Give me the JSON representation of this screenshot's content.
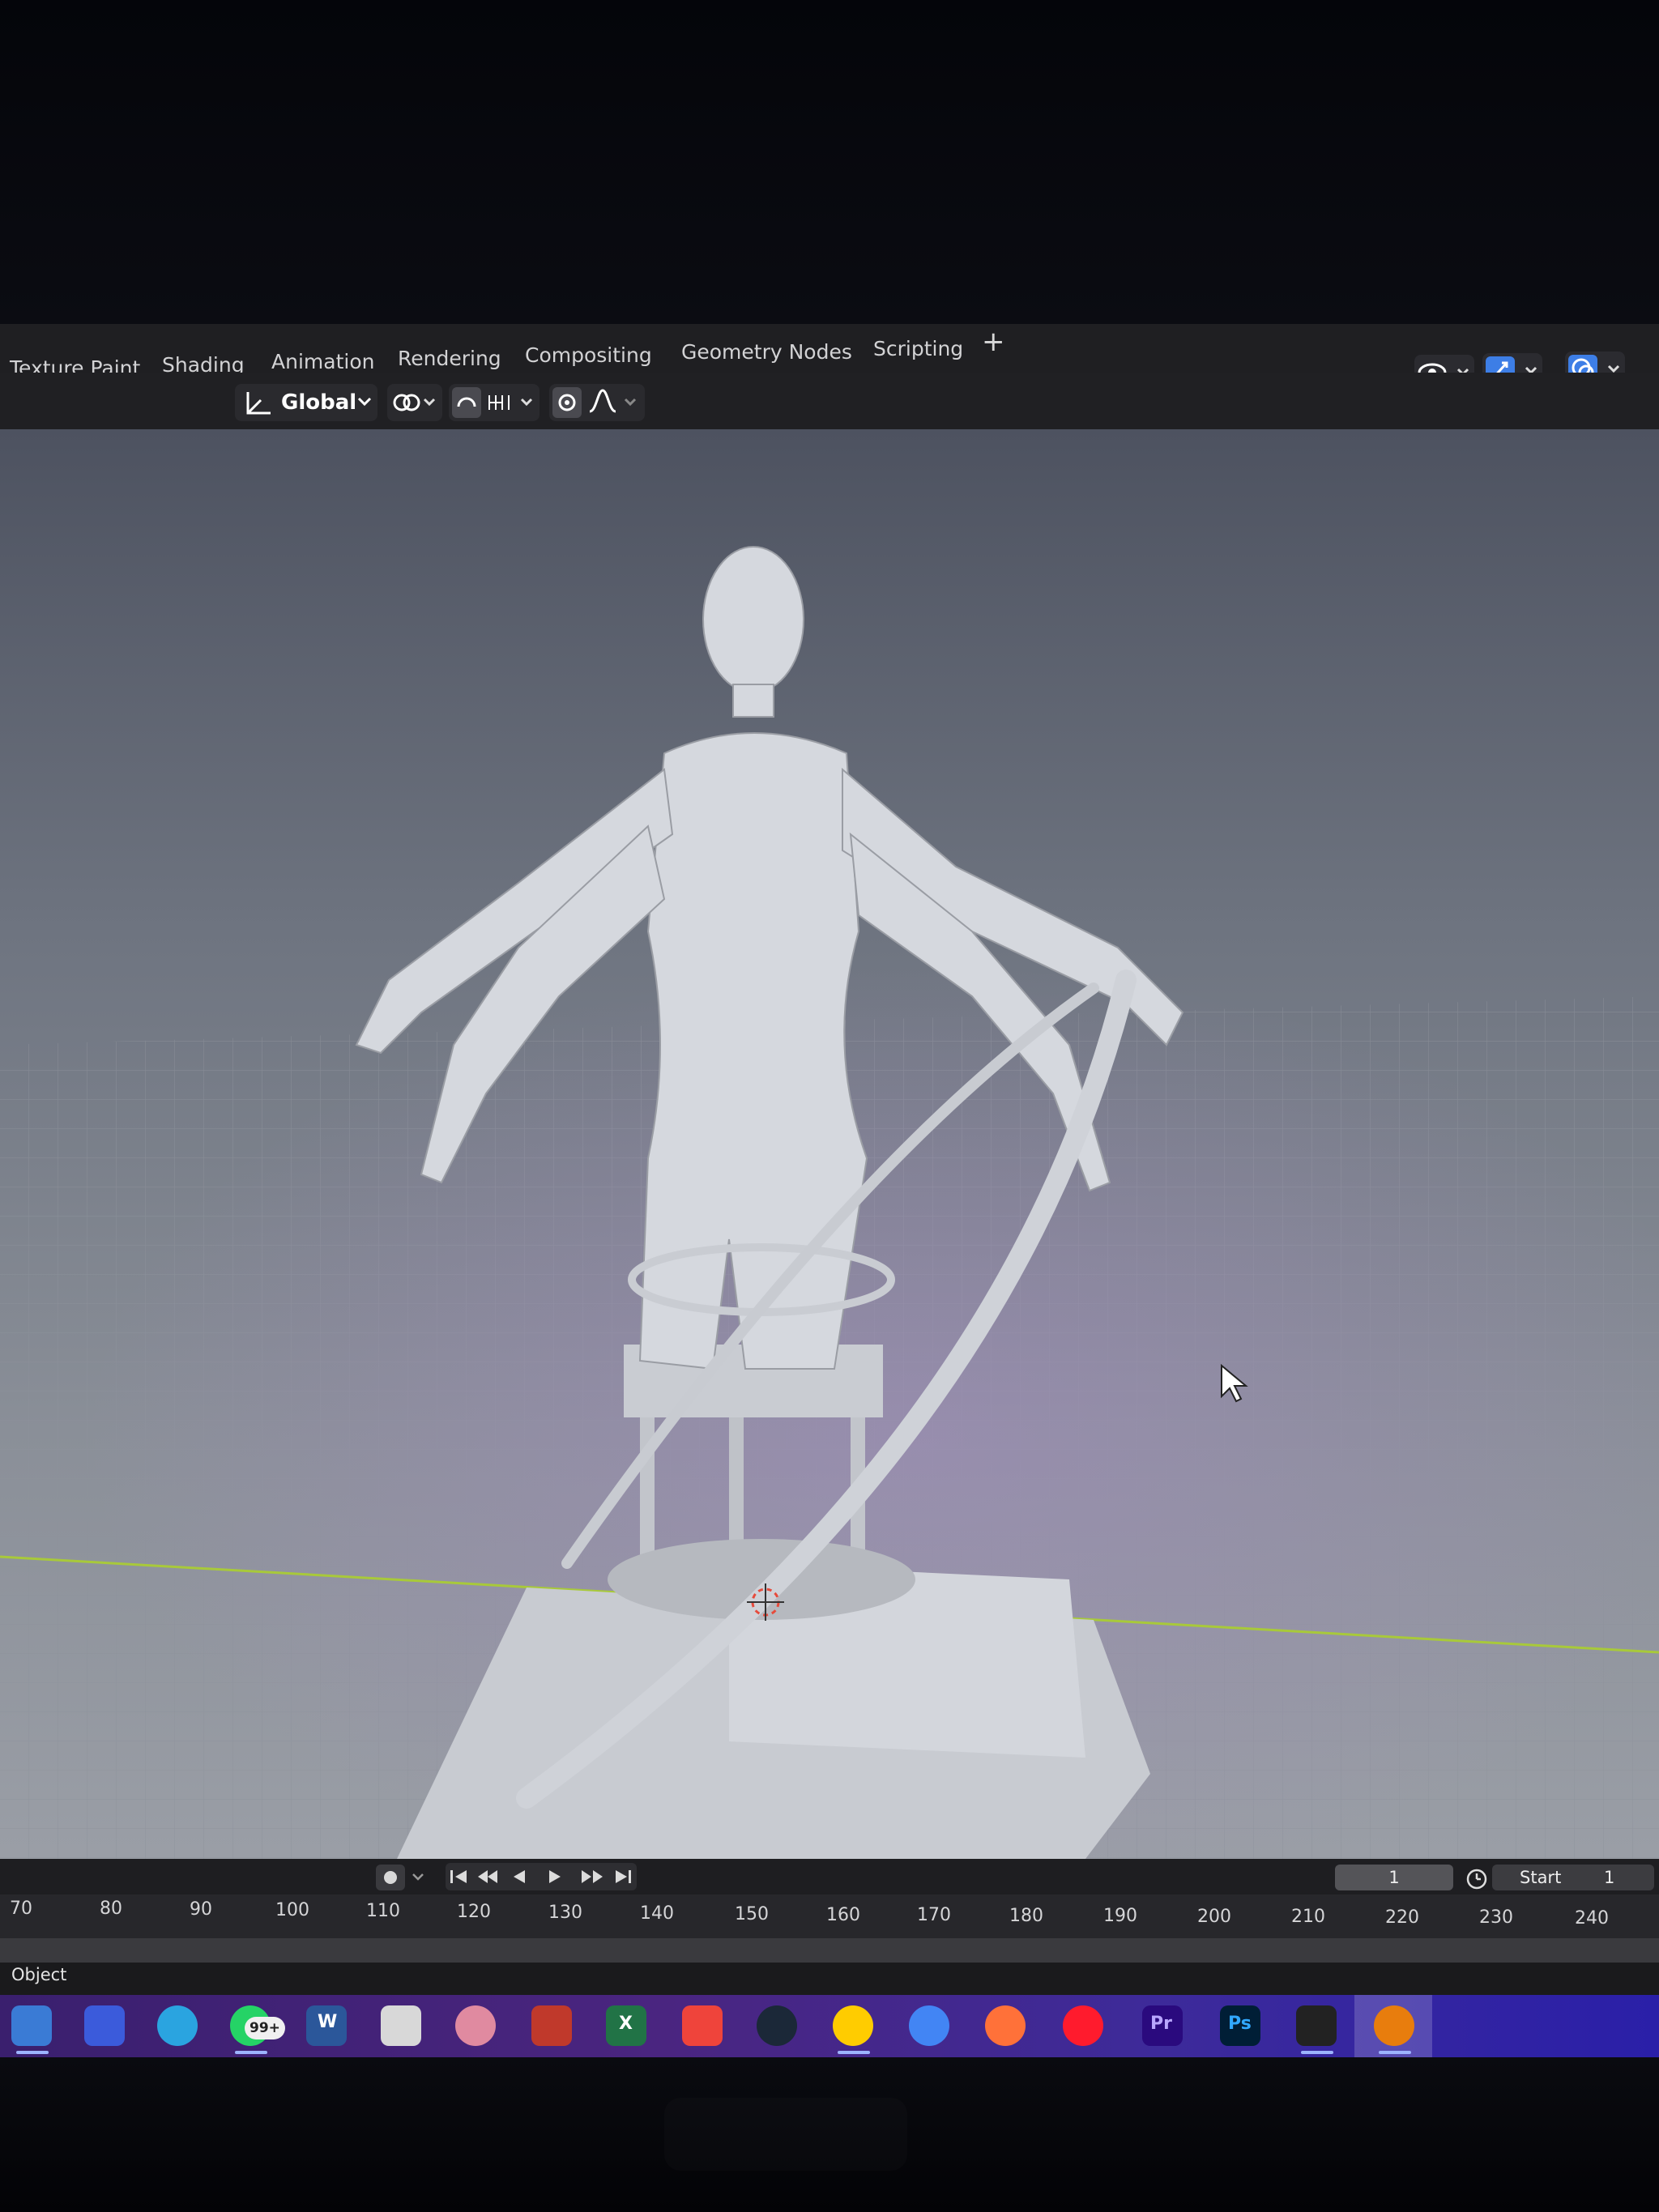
{
  "workspace_tabs": [
    "Texture Paint",
    "Shading",
    "Animation",
    "Rendering",
    "Compositing",
    "Geometry Nodes",
    "Scripting"
  ],
  "add_tab_symbol": "+",
  "toolbar": {
    "orientation": "Global"
  },
  "timeline": {
    "ruler_ticks": [
      "70",
      "80",
      "90",
      "100",
      "110",
      "120",
      "130",
      "140",
      "150",
      "160",
      "170",
      "180",
      "190",
      "200",
      "210",
      "220",
      "230",
      "240"
    ],
    "current_frame": "1",
    "start_label": "Start",
    "start_value": "1"
  },
  "status_bar": {
    "mode": "Object"
  },
  "taskbar": {
    "notification_badge": "99+",
    "apps": [
      {
        "name": "browser-pinned",
        "color": "#3a7bd5"
      },
      {
        "name": "app-2",
        "color": "#3b5bdb"
      },
      {
        "name": "telegram",
        "color": "#2aa4e0"
      },
      {
        "name": "whatsapp",
        "color": "#25d366"
      },
      {
        "name": "word",
        "color": "#2b579a"
      },
      {
        "name": "notes",
        "color": "#d8d8d8"
      },
      {
        "name": "brain-app",
        "color": "#e08aa0"
      },
      {
        "name": "recorder",
        "color": "#c0392b"
      },
      {
        "name": "excel",
        "color": "#217346"
      },
      {
        "name": "anydesk",
        "color": "#ef443b"
      },
      {
        "name": "steam",
        "color": "#1b2838"
      },
      {
        "name": "yandex-browser",
        "color": "#ffcc00"
      },
      {
        "name": "chrome",
        "color": "#4285f4"
      },
      {
        "name": "firefox",
        "color": "#ff7139"
      },
      {
        "name": "opera",
        "color": "#ff1b2d"
      },
      {
        "name": "premiere-pro",
        "color": "#2a0a7e"
      },
      {
        "name": "photoshop",
        "color": "#001e36"
      },
      {
        "name": "capcut",
        "color": "#222222"
      },
      {
        "name": "blender",
        "color": "#e87d0d"
      }
    ],
    "premiere_label": "Pr",
    "photoshop_label": "Ps",
    "word_label": "W",
    "excel_label": "X"
  }
}
